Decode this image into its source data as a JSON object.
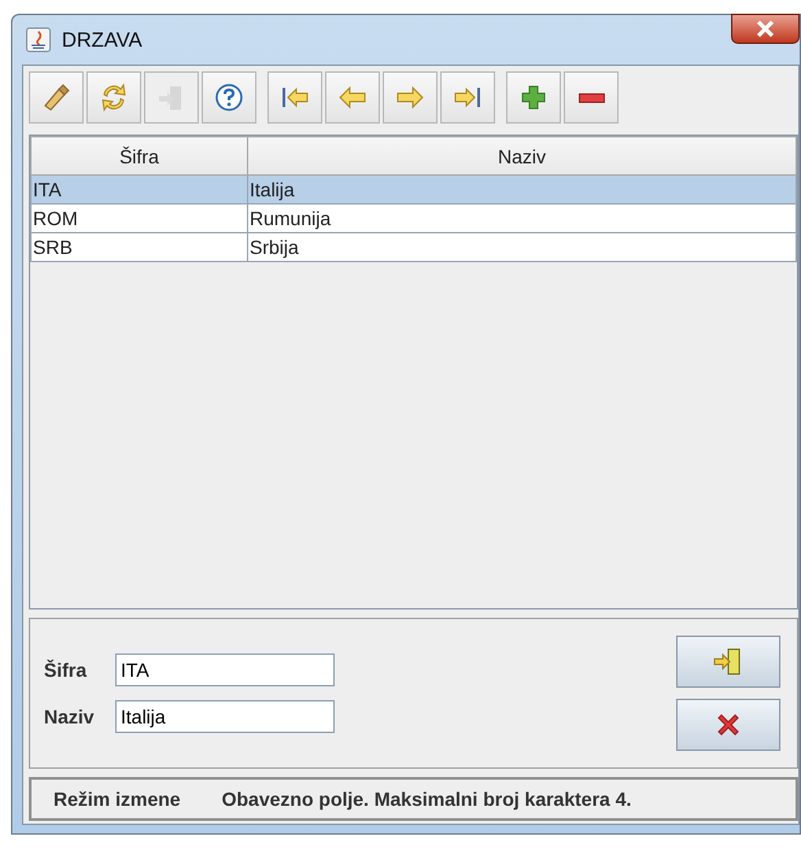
{
  "window": {
    "title": "DRZAVA"
  },
  "toolbar": [
    [
      {
        "kind": "edit",
        "disabled": false
      },
      {
        "kind": "refresh",
        "disabled": false
      },
      {
        "kind": "door",
        "disabled": true
      },
      {
        "kind": "help",
        "disabled": false
      }
    ],
    [
      {
        "kind": "first",
        "disabled": false
      },
      {
        "kind": "prev",
        "disabled": false
      },
      {
        "kind": "next",
        "disabled": false
      },
      {
        "kind": "last",
        "disabled": false
      }
    ],
    [
      {
        "kind": "add",
        "disabled": false
      },
      {
        "kind": "remove",
        "disabled": false
      }
    ]
  ],
  "table": {
    "columns": [
      "Šifra",
      "Naziv"
    ],
    "rows": [
      {
        "cells": [
          "ITA",
          "Italija"
        ],
        "selected": true
      },
      {
        "cells": [
          "ROM",
          "Rumunija"
        ],
        "selected": false
      },
      {
        "cells": [
          "SRB",
          "Srbija"
        ],
        "selected": false
      }
    ]
  },
  "form": {
    "fields": [
      {
        "label": "Šifra",
        "value": "ITA"
      },
      {
        "label": "Naziv",
        "value": "Italija"
      }
    ],
    "buttons": [
      {
        "kind": "confirm"
      },
      {
        "kind": "cancel"
      }
    ]
  },
  "status_bar": {
    "mode": "Režim izmene",
    "message": "Obavezno polje. Maksimalni broj karaktera 4."
  }
}
